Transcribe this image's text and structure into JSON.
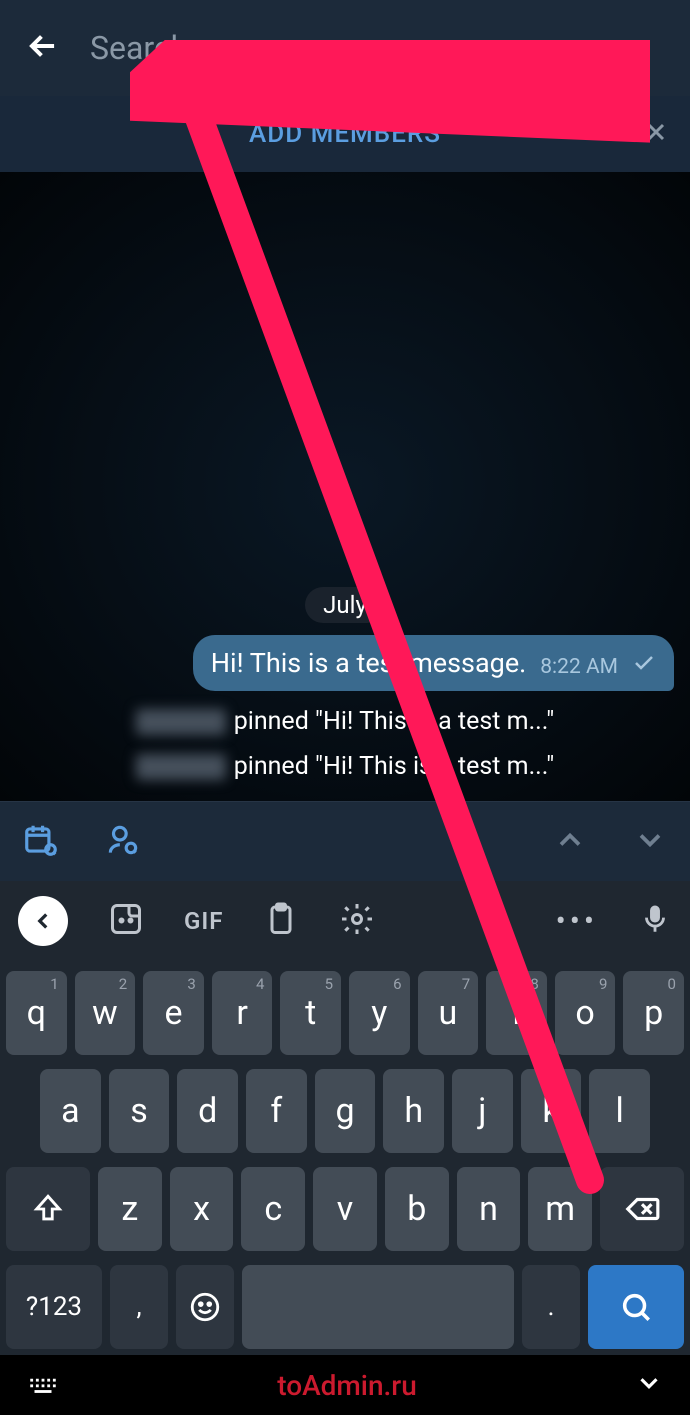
{
  "header": {
    "search_placeholder": "Search",
    "search_value": ""
  },
  "banner": {
    "label": "ADD MEMBERS"
  },
  "chat": {
    "date_label": "July",
    "message": {
      "text": "Hi! This is a test message.",
      "time": "8:22 AM"
    },
    "pinned_1": " pinned \"Hi! This is a test m...\"",
    "pinned_2": " pinned \"Hi! This is a test m...\""
  },
  "keyboard_suggest": {
    "gif_label": "GIF"
  },
  "keyboard": {
    "row1": [
      {
        "main": "q",
        "sup": "1"
      },
      {
        "main": "w",
        "sup": "2"
      },
      {
        "main": "e",
        "sup": "3"
      },
      {
        "main": "r",
        "sup": "4"
      },
      {
        "main": "t",
        "sup": "5"
      },
      {
        "main": "y",
        "sup": "6"
      },
      {
        "main": "u",
        "sup": "7"
      },
      {
        "main": "i",
        "sup": "8"
      },
      {
        "main": "o",
        "sup": "9"
      },
      {
        "main": "p",
        "sup": "0"
      }
    ],
    "row2": [
      "a",
      "s",
      "d",
      "f",
      "g",
      "h",
      "j",
      "k",
      "l"
    ],
    "row3": [
      "z",
      "x",
      "c",
      "v",
      "b",
      "n",
      "m"
    ],
    "sym_label": "?123",
    "comma": ",",
    "period": "."
  },
  "nav": {
    "domain": "toAdmin.ru"
  },
  "annotation": {
    "color": "#ff1858"
  }
}
